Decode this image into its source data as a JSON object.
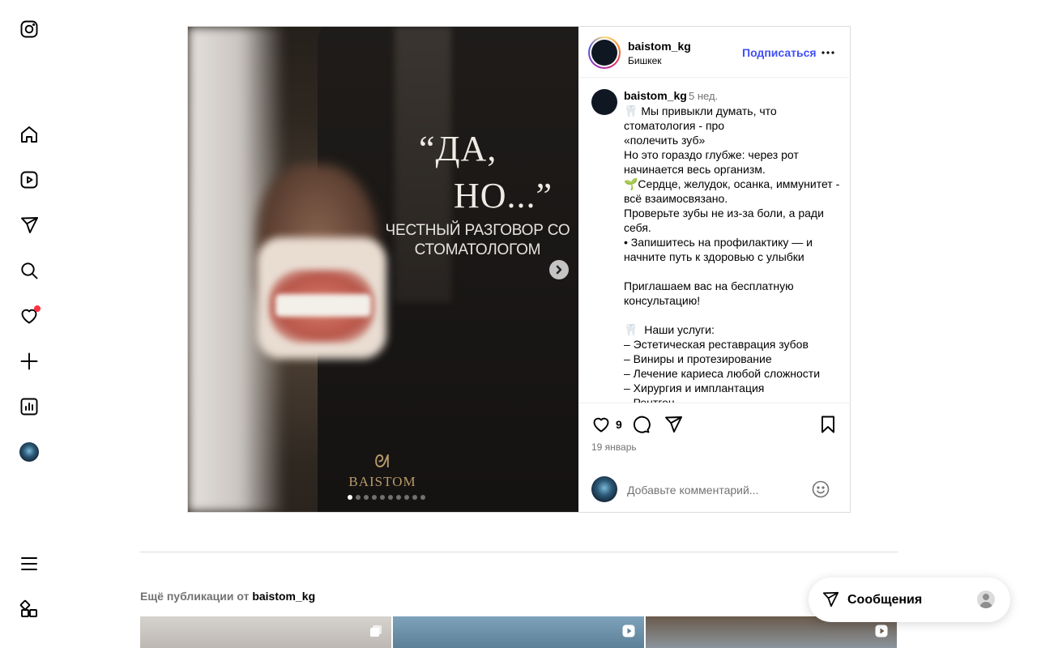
{
  "nav": {
    "items": [
      {
        "icon": "instagram-logo-icon"
      },
      {
        "icon": "home-icon"
      },
      {
        "icon": "reels-icon"
      },
      {
        "icon": "direct-messages-icon"
      },
      {
        "icon": "search-icon"
      },
      {
        "icon": "notifications-heart-icon",
        "badge": true
      },
      {
        "icon": "create-plus-icon"
      },
      {
        "icon": "dashboard-icon"
      },
      {
        "icon": "profile-avatar-icon"
      },
      {
        "icon": "menu-icon"
      },
      {
        "icon": "more-apps-icon"
      }
    ]
  },
  "post": {
    "media": {
      "quote_line1": "“ДА,",
      "quote_line2": "НО...”",
      "subtitle": "ЧЕСТНЫЙ РАЗГОВОР СО СТОМАТОЛОГОМ",
      "brand_logo": "BAISTOM",
      "slides_total": 10,
      "slide_active": 1
    },
    "header": {
      "username": "baistom_kg",
      "location": "Бишкек",
      "follow_label": "Подписаться"
    },
    "caption": {
      "username": "baistom_kg",
      "time_ago": "5 нед.",
      "text": "🦷 Мы привыкли думать, что стоматология - про\n«полечить зуб»\nНо это гораздо глубже: через рот начинается весь организм.\n🌱Сердце, желудок, осанка, иммунитет - всё взаимосвязано.\nПроверьте зубы не из-за боли, а ради себя.\n• Запишитесь на профилактику — и начните путь к здоровью с улыбки\n\nПриглашаем вас на бесплатную консультацию!\n\n🦷  Наши услуги:\n– Эстетическая реставрация зубов\n– Виниры и протезирование\n– Лечение кариеса любой сложности\n– Хирургия и имплантация\n– Рентген"
    },
    "actions": {
      "like_count": "9",
      "date": "19 январь"
    },
    "comment": {
      "placeholder": "Добавьте комментарий..."
    }
  },
  "more_posts": {
    "prefix": "Ещё публикации от",
    "username": "baistom_kg",
    "thumbs": [
      {
        "type_icon": "carousel-icon"
      },
      {
        "type_icon": "reel-icon"
      },
      {
        "type_icon": "reel-icon"
      }
    ]
  },
  "messages_pill": {
    "label": "Сообщения"
  },
  "colors": {
    "accent_blue": "#4150f7",
    "notification_red": "#ff3040",
    "secondary_text": "#737373",
    "border": "#dbdbdb",
    "logo_gold": "#b79a6a"
  }
}
